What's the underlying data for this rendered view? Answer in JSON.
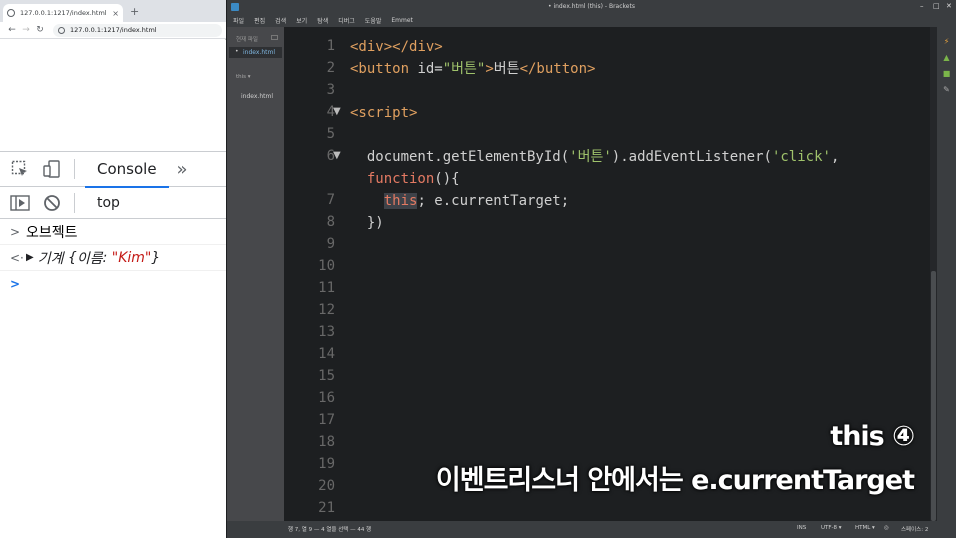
{
  "browser": {
    "tab_title": "127.0.0.1:1217/index.html",
    "tab_close": "×",
    "new_tab": "+",
    "url": "127.0.0.1:1217/index.html"
  },
  "devtools": {
    "console_tab": "Console",
    "more_tabs": "»",
    "context": "top",
    "lines": [
      {
        "prefix": ">",
        "text": "오브젝트"
      },
      {
        "prefix": "<·",
        "type_label": "기계",
        "object_open": "{",
        "key": "이름",
        "colon": ":",
        "value": "\"Kim\"",
        "object_close": "}"
      },
      {
        "prefix": ">",
        "text": ""
      }
    ]
  },
  "brackets": {
    "window_title": "• index.html (this) - Brackets",
    "menu": [
      "파일",
      "편집",
      "검색",
      "보기",
      "탐색",
      "디버그",
      "도움말",
      "Emmet"
    ],
    "sidebar": {
      "working_files": "현재 파일",
      "active_file": "index.html",
      "project": "this ▾",
      "project_file": "index.html"
    },
    "line_numbers": [
      "1",
      "2",
      "3",
      "4",
      "5",
      "6",
      "",
      "7",
      "8",
      "9",
      "10",
      "11",
      "12",
      "13",
      "14",
      "15",
      "16",
      "17",
      "18",
      "19",
      "20",
      "21"
    ],
    "code": {
      "l1_open": "<div>",
      "l1_close": "</div>",
      "l2_open_tag": "<button",
      "l2_attr": " id=",
      "l2_val": "\"버튼\"",
      "l2_gt": ">",
      "l2_text": "버튼",
      "l2_close": "</button>",
      "l4_tag": "<script>",
      "l6_a": "  document.getElementById(",
      "l6_str": "'버튼'",
      "l6_b": ").addEventListener(",
      "l6_str2": "'click'",
      "l6_c": ",",
      "l6w_kw": "  function",
      "l6w_rest": "(){",
      "l7_pre": "    ",
      "l7_this": "this",
      "l7_rest": "; e.currentTarget;",
      "l8": "  })"
    },
    "status": {
      "position": "행 7, 열 9 — 4 열을 선택 — 44 행",
      "ins": "INS",
      "encoding": "UTF-8 ▾",
      "language": "HTML ▾",
      "spaces": "스페이스: 2"
    }
  },
  "caption": {
    "line1": "this ④",
    "line2": "이벤트리스너 안에서는 e.currentTarget"
  },
  "colors": {
    "editor_bg": "#1d1f21",
    "tag": "#e0a060",
    "string": "#9fc26b",
    "keyword": "#e47a63",
    "devtools_accent": "#1a73e8"
  }
}
